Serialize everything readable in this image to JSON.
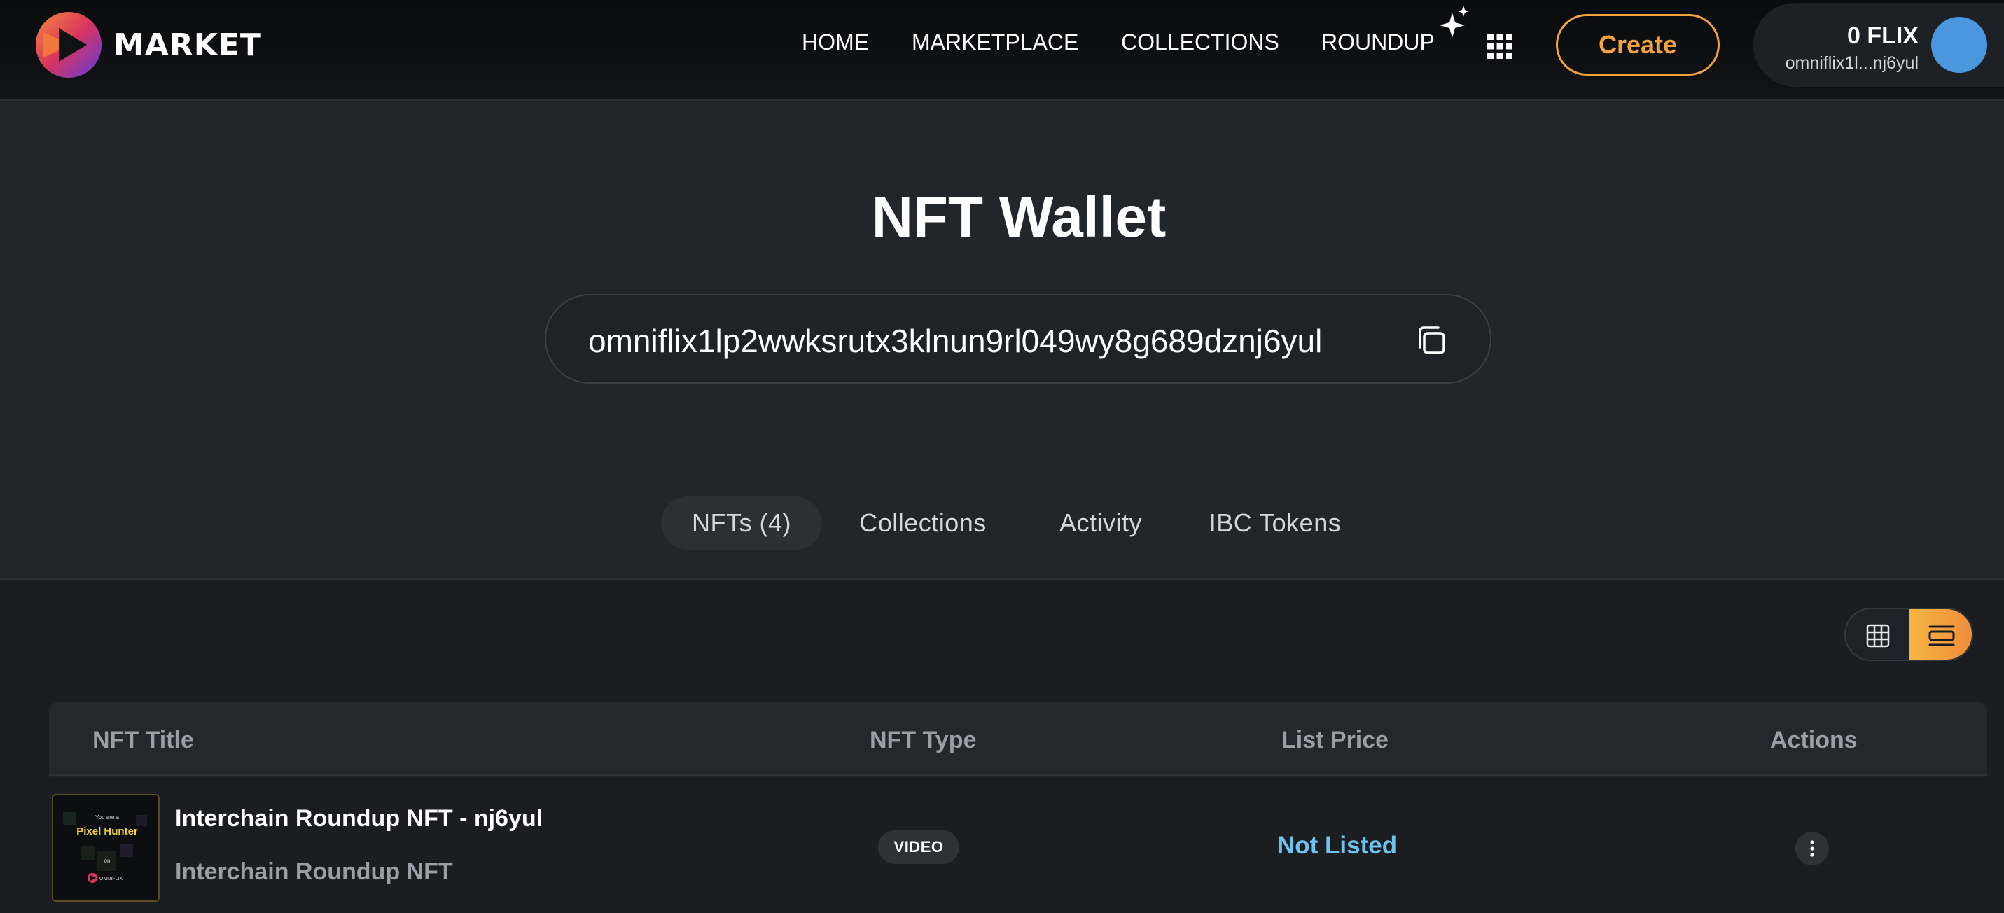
{
  "brand": {
    "name": "MARKET"
  },
  "nav": {
    "items": [
      {
        "label": "HOME"
      },
      {
        "label": "MARKETPLACE"
      },
      {
        "label": "COLLECTIONS"
      },
      {
        "label": "ROUNDUP"
      }
    ],
    "create_label": "Create"
  },
  "wallet": {
    "balance": "0 FLIX",
    "address_short": "omniflix1l...nj6yul"
  },
  "page": {
    "title": "NFT Wallet",
    "address": "omniflix1lp2wwksrutx3klnun9rl049wy8g689dznj6yul"
  },
  "tabs": [
    {
      "label": "NFTs (4)",
      "active": true
    },
    {
      "label": "Collections",
      "active": false
    },
    {
      "label": "Activity",
      "active": false
    },
    {
      "label": "IBC Tokens",
      "active": false
    }
  ],
  "view_toggle": {
    "selected": "list"
  },
  "table": {
    "columns": [
      "NFT Title",
      "NFT Type",
      "List Price",
      "Actions"
    ],
    "rows": [
      {
        "title": "Interchain Roundup NFT - nj6yul",
        "collection": "Interchain Roundup NFT",
        "type": "VIDEO",
        "price": "Not Listed",
        "thumb": {
          "line1": "You are a",
          "line2": "Pixel Hunter",
          "line3": "on",
          "brand": "OMNIFLIX"
        }
      }
    ]
  },
  "colors": {
    "accent": "#f3a33d",
    "price_link": "#6cc3ee",
    "avatar": "#4a97dd"
  },
  "icons": {
    "logo": "play-logo-icon",
    "sparkle": "sparkle-icon",
    "apps": "apps-grid-icon",
    "copy": "copy-icon",
    "grid_view": "grid-view-icon",
    "list_view": "list-view-icon",
    "more": "more-vertical-icon"
  }
}
